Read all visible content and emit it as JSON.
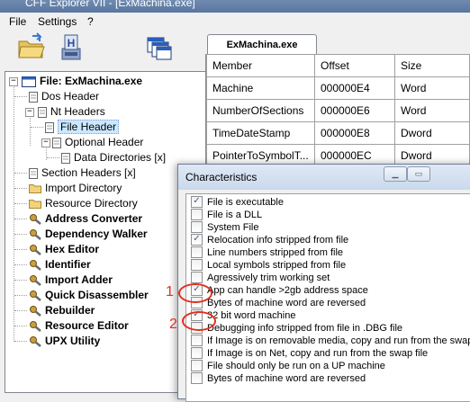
{
  "window": {
    "title": "CFF Explorer VII - [ExMachina.exe]"
  },
  "menu": {
    "file": "File",
    "settings": "Settings",
    "help": "?"
  },
  "toolbar": {
    "open_icon": "open-folder-icon",
    "hex_icon": "hex-editor-icon",
    "windows_icon": "windows-icon"
  },
  "tree": {
    "root": "File: ExMachina.exe",
    "items": [
      "Dos Header",
      "Nt Headers",
      "File Header",
      "Optional Header",
      "Data Directories [x]",
      "Section Headers [x]",
      "Import Directory",
      "Resource Directory",
      "Address Converter",
      "Dependency Walker",
      "Hex Editor",
      "Identifier",
      "Import Adder",
      "Quick Disassembler",
      "Rebuilder",
      "Resource Editor",
      "UPX Utility"
    ]
  },
  "tab": {
    "label": "ExMachina.exe"
  },
  "grid": {
    "headers": [
      "Member",
      "Offset",
      "Size"
    ],
    "rows": [
      [
        "Machine",
        "000000E4",
        "Word"
      ],
      [
        "NumberOfSections",
        "000000E6",
        "Word"
      ],
      [
        "TimeDateStamp",
        "000000E8",
        "Dword"
      ],
      [
        "PointerToSymbolT...",
        "000000EC",
        "Dword"
      ]
    ]
  },
  "dialog": {
    "title": "Characteristics",
    "items": [
      {
        "label": "File is executable",
        "checked": true
      },
      {
        "label": "File is a DLL",
        "checked": false
      },
      {
        "label": "System File",
        "checked": false
      },
      {
        "label": "Relocation info stripped from file",
        "checked": true
      },
      {
        "label": "Line numbers stripped from file",
        "checked": false
      },
      {
        "label": "Local symbols stripped from file",
        "checked": false
      },
      {
        "label": "Agressively trim working set",
        "checked": false
      },
      {
        "label": "App can handle >2gb address space",
        "checked": true
      },
      {
        "label": "Bytes of machine word are reversed",
        "checked": false
      },
      {
        "label": "32 bit word machine",
        "checked": true
      },
      {
        "label": "Debugging info stripped from file in .DBG file",
        "checked": false
      },
      {
        "label": "If Image is on removable media, copy and run from the swap",
        "checked": false
      },
      {
        "label": "If Image is on Net, copy and run from the swap file",
        "checked": false
      },
      {
        "label": "File should only be run on a UP machine",
        "checked": false
      },
      {
        "label": "Bytes of machine word are reversed",
        "checked": false
      }
    ]
  },
  "annotations": {
    "one": "1",
    "two": "2"
  },
  "colors": {
    "annotation": "#e0301e",
    "selection": "#cce8ff",
    "titlebar": "#5a76a0"
  }
}
